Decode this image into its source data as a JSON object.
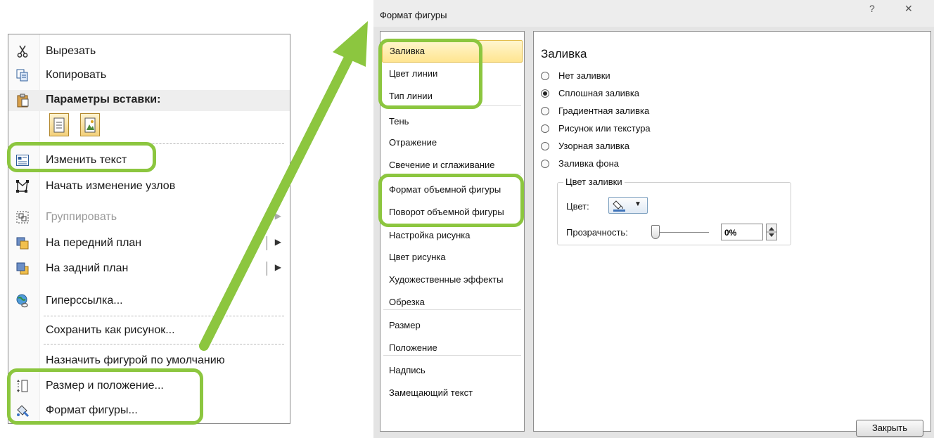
{
  "context_menu": {
    "cut": "Вырезать",
    "copy": "Копировать",
    "paste_options": "Параметры вставки:",
    "edit_text": "Изменить текст",
    "edit_points": "Начать изменение узлов",
    "group": "Группировать",
    "bring_front": "На передний план",
    "send_back": "На задний план",
    "hyperlink": "Гиперссылка...",
    "save_picture": "Сохранить как рисунок...",
    "set_default": "Назначить фигурой по умолчанию",
    "size_position": "Размер и положение...",
    "format_shape": "Формат фигуры..."
  },
  "dialog": {
    "title": "Формат фигуры",
    "help": "?",
    "close_glyph": "✕",
    "nav": [
      "Заливка",
      "Цвет линии",
      "Тип линии",
      "Тень",
      "Отражение",
      "Свечение и сглаживание",
      "Формат объемной фигуры",
      "Поворот объемной фигуры",
      "Настройка рисунка",
      "Цвет рисунка",
      "Художественные эффекты",
      "Обрезка",
      "Размер",
      "Положение",
      "Надпись",
      "Замещающий текст"
    ],
    "selected_nav": "Заливка",
    "section_title": "Заливка",
    "fill_options": [
      "Нет заливки",
      "Сплошная заливка",
      "Градиентная заливка",
      "Рисунок или текстура",
      "Узорная заливка",
      "Заливка фона"
    ],
    "selected_fill": "Сплошная заливка",
    "fill_color_group": "Цвет заливки",
    "color_label": "Цвет:",
    "transparency_label": "Прозрачность:",
    "transparency_value": "0%",
    "transparency_level": 0,
    "close_button": "Закрыть"
  },
  "highlight_color": "#8cc63f"
}
